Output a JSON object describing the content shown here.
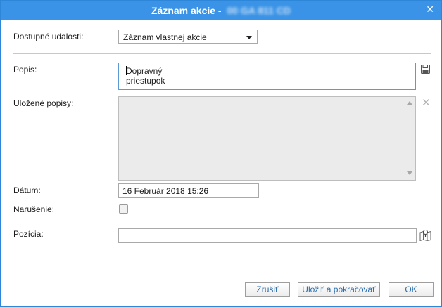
{
  "dialog": {
    "title": "Záznam akcie -",
    "plate": "00 GA 811 CD",
    "close_icon": "close-icon"
  },
  "form": {
    "events_label": "Dostupné udalosti:",
    "events_value": "Záznam vlastnej akcie",
    "description_label": "Popis:",
    "description_value": "Dopravný priestupok",
    "saved_label": "Uložené popisy:",
    "date_label": "Dátum:",
    "date_value": "16 Február 2018 15:26",
    "violation_label": "Narušenie:",
    "violation_checked": false,
    "position_label": "Pozícia:",
    "position_value": ""
  },
  "icons": {
    "save": "floppy-disk-icon",
    "delete": "close-icon",
    "map": "map-pin-icon"
  },
  "buttons": {
    "cancel": "Zrušiť",
    "save_continue": "Uložiť a pokračovať",
    "ok": "OK"
  },
  "colors": {
    "titlebar": "#3a93e6",
    "button_text": "#2a6db0",
    "focus_border": "#5b9bd5"
  }
}
